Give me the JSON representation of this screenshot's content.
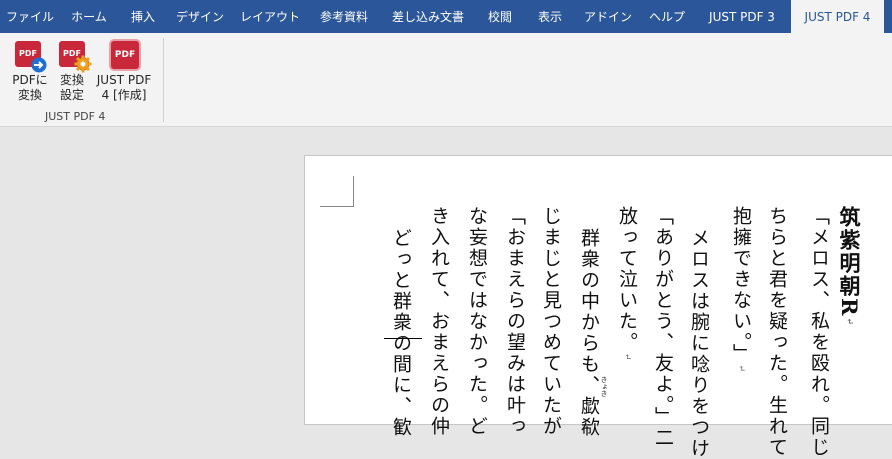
{
  "tabs": [
    {
      "label": "ファイル"
    },
    {
      "label": "ホーム"
    },
    {
      "label": "挿入"
    },
    {
      "label": "デザイン"
    },
    {
      "label": "レイアウト"
    },
    {
      "label": "参考資料"
    },
    {
      "label": "差し込み文書"
    },
    {
      "label": "校閲"
    },
    {
      "label": "表示"
    },
    {
      "label": "アドイン"
    },
    {
      "label": "ヘルプ"
    },
    {
      "label": "JUST PDF 3"
    },
    {
      "label": "JUST PDF 4"
    }
  ],
  "ribbon": {
    "buttons": [
      {
        "line1": "PDFに",
        "line2": "変換"
      },
      {
        "line1": "変換",
        "line2": "設定"
      },
      {
        "line1": "JUST PDF",
        "line2": "4 [作成]"
      }
    ],
    "icon_text": "PDF",
    "group_label": "JUST PDF 4"
  },
  "document": {
    "columns": [
      "筑紫明朝R",
      "「メロス、私を殴れ。同じ",
      "ちらと君を疑った。生れて",
      "抱擁できない。」",
      "メロスは腕に唸りをつけ",
      "「ありがとう、友よ。」二",
      "放って泣いた。",
      "群衆の中からも、歔欷",
      "じまじと見つめていたが",
      "「おまえらの望みは叶っ",
      "な妄想ではなかった。ど",
      "き入れて、おまえらの仲",
      "どっと群衆の間に、歓"
    ],
    "ruby": "きょき",
    "para_mark": "↵"
  },
  "colors": {
    "tab_bar": "#2b579a",
    "ribbon_bg": "#f3f3f3",
    "pdf_red": "#c9283a"
  }
}
